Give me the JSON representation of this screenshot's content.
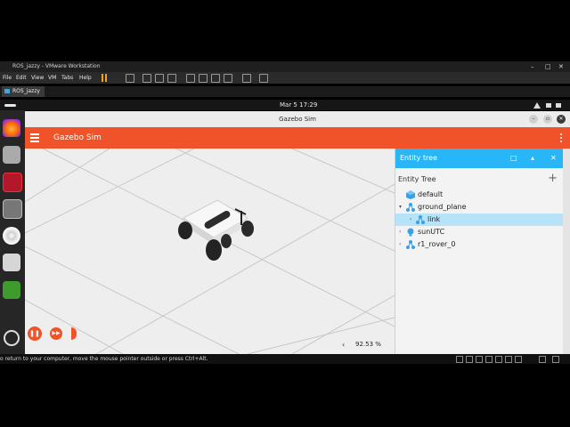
{
  "vmware": {
    "window_title": "ROS_jazzy - VMware Workstation",
    "menu": [
      "File",
      "Edit",
      "View",
      "VM",
      "Tabs",
      "Help"
    ],
    "tab_label": "ROS_jazzy",
    "status_hint": "o return to your computer, move the mouse pointer outside or press Ctrl+Alt."
  },
  "ubuntu": {
    "clock": "Mar 5  17:29"
  },
  "gazebo": {
    "window_title": "Gazebo Sim",
    "app_title": "Gazebo Sim",
    "real_time_factor": "92.53 %",
    "real_time_arrow": "‹"
  },
  "entity_panel": {
    "header": "Entity tree",
    "subtitle": "Entity Tree",
    "add_symbol": "+",
    "items": [
      {
        "label": "default",
        "arrow": "",
        "selected": false
      },
      {
        "label": "ground_plane",
        "arrow": "▾",
        "selected": false
      },
      {
        "label": "link",
        "arrow": "›",
        "selected": true
      },
      {
        "label": "sunUTC",
        "arrow": "›",
        "selected": false
      },
      {
        "label": "r1_rover_0",
        "arrow": "›",
        "selected": false
      }
    ]
  },
  "colors": {
    "gazebo_accent": "#f0532a",
    "panel_header": "#29b6f6",
    "selected_row": "#b6e3f7",
    "vm_pause": "#f2a31b"
  }
}
